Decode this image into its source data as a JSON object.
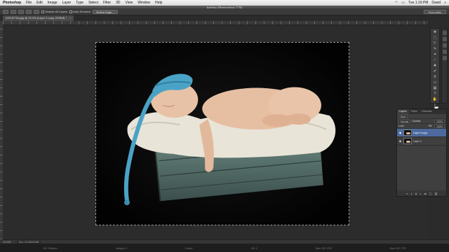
{
  "menubar": {
    "app": "Photoshop",
    "items": [
      "File",
      "Edit",
      "Image",
      "Layer",
      "Type",
      "Select",
      "Filter",
      "3D",
      "View",
      "Window",
      "Help"
    ],
    "time": "Tue 1:19 PM",
    "user": "David"
  },
  "window": {
    "title": "Adobe Photoshop CS6"
  },
  "options": {
    "sample_all_layers": "Sample All Layers",
    "auto_enhance": "Auto-Enhance",
    "refine_edge": "Refine Edge...",
    "workspace": "Essentials"
  },
  "document": {
    "tab_title": "DSC8779a.jpg @ 33.3% (Layer 0 copy, RGB/8) *",
    "zoom": "33.33%",
    "doc_size": "Doc: 24.9M/49.8M"
  },
  "layers_panel": {
    "tabs": [
      "Layers",
      "Paths",
      "Channels"
    ],
    "kind_label": "Kind",
    "blend_mode": "Normal",
    "opacity_label": "Opacity:",
    "opacity": "100%",
    "lock_label": "Lock:",
    "fill_label": "Fill:",
    "fill": "100%",
    "layers": [
      {
        "name": "Layer 0 copy",
        "active": true
      },
      {
        "name": "Layer 0",
        "active": false
      }
    ]
  },
  "dock": [
    "HD Sixteen",
    "Images 1",
    "Under",
    "HD 1",
    "Mac HD 3TB",
    "Mac HD 1TB"
  ],
  "colors": {
    "accent": "#4d6a9e",
    "canvas_bg": "#050505",
    "hat": "#4aa3c6",
    "crate": "#4f6f6c",
    "fur": "#e9e4d8",
    "skin": "#e6bfa3"
  }
}
